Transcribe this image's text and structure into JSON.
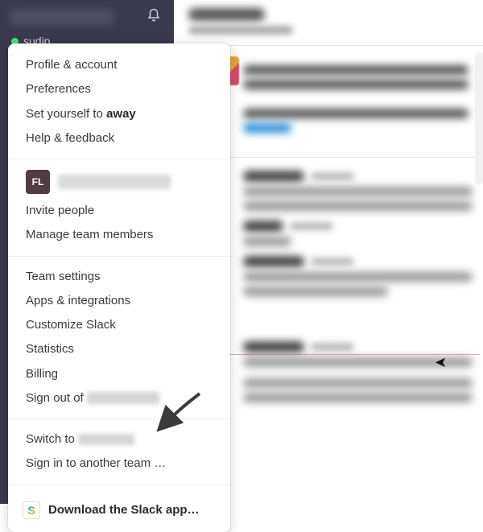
{
  "sidebar": {
    "username": "sudip"
  },
  "menu": {
    "profile": "Profile & account",
    "preferences": "Preferences",
    "set_away_prefix": "Set yourself to ",
    "set_away_bold": "away",
    "help": "Help & feedback",
    "team_badge": "FL",
    "invite": "Invite people",
    "manage_members": "Manage team members",
    "team_settings": "Team settings",
    "apps": "Apps & integrations",
    "customize": "Customize Slack",
    "statistics": "Statistics",
    "billing": "Billing",
    "sign_out_prefix": "Sign out of ",
    "switch_to_prefix": "Switch to ",
    "sign_in_another": "Sign in to another team …",
    "download": "Download the Slack app…"
  }
}
